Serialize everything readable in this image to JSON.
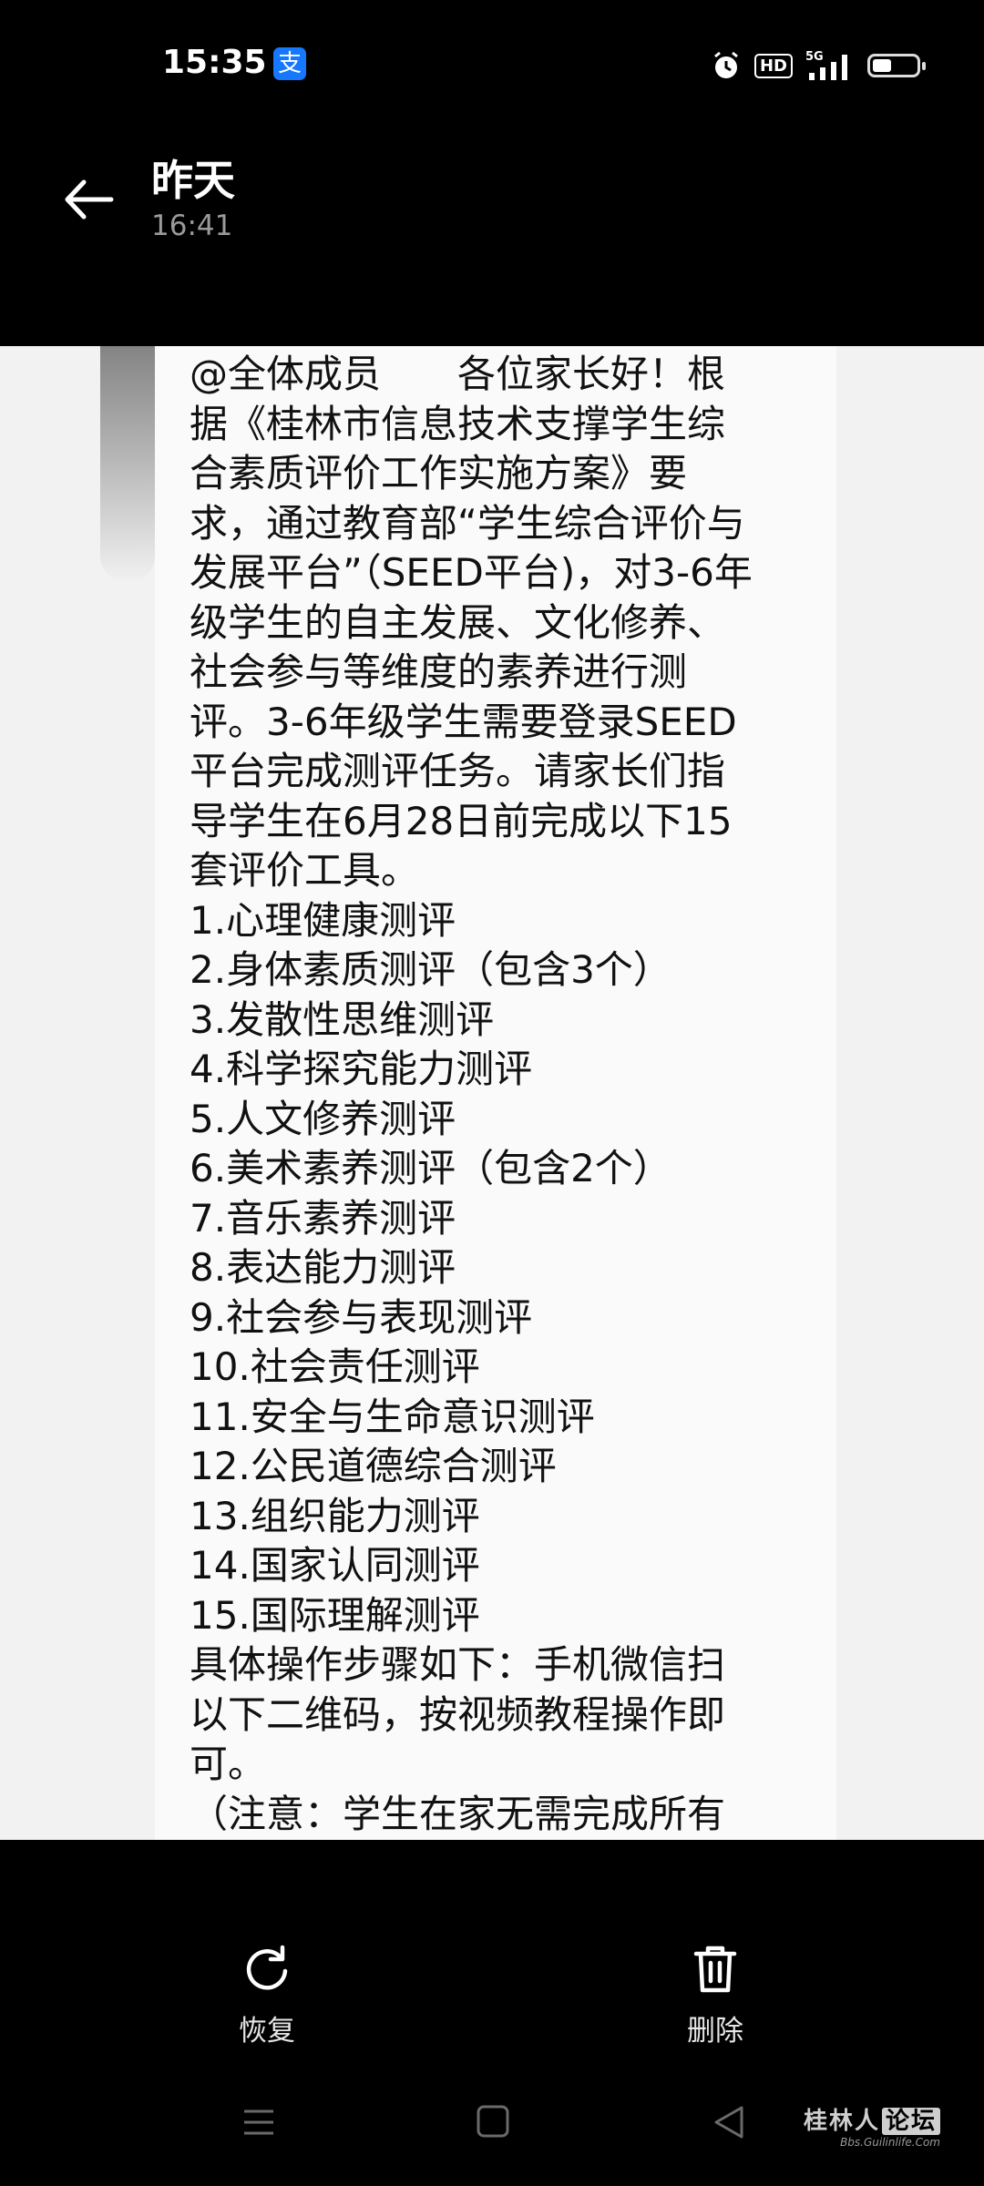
{
  "status_bar": {
    "time": "15:35",
    "app_badge_glyph": "支",
    "hd_label": "HD",
    "network_label": "5G",
    "icons": [
      "alipay-icon",
      "alarm-icon",
      "hd-icon",
      "signal-icon",
      "battery-icon"
    ],
    "battery_level": 0.45
  },
  "header": {
    "title": "昨天",
    "subtitle": "16:41"
  },
  "message": {
    "lines": [
      "@全体成员　　各位家长好！根",
      "据《桂林市信息技术支撑学生综",
      "合素质评价工作实施方案》要",
      "求，通过教育部“学生综合评价与",
      "发展平台”（SEED平台)，对3-6年",
      "级学生的自主发展、文化修养、",
      "社会参与等维度的素养进行测",
      "评。3-6年级学生需要登录SEED",
      "平台完成测评任务。请家长们指",
      "导学生在6月28日前完成以下15",
      "套评价工具。",
      "1.心理健康测评",
      "2.身体素质测评（包含3个）",
      "3.发散性思维测评",
      "4.科学探究能力测评",
      "5.人文修养测评",
      "6.美术素养测评（包含2个）",
      "7.音乐素养测评",
      "8.表达能力测评",
      "9.社会参与表现测评",
      "10.社会责任测评",
      "11.安全与生命意识测评",
      "12.公民道德综合测评",
      "13.组织能力测评",
      "14.国家认同测评",
      "15.国际理解测评",
      "具体操作步骤如下：手机微信扫",
      "以下二维码，按视频教程操作即",
      "可。",
      "（注意：学生在家无需完成所有"
    ]
  },
  "actions": {
    "restore_label": "恢复",
    "delete_label": "删除"
  },
  "watermark": {
    "text_main": "桂林人",
    "text_tag": "论坛",
    "url": "Bbs.Guilinlife.Com"
  },
  "colors": {
    "background": "#000000",
    "paper": "#fafafa",
    "text": "#111111",
    "alipay_blue": "#1677ff"
  }
}
